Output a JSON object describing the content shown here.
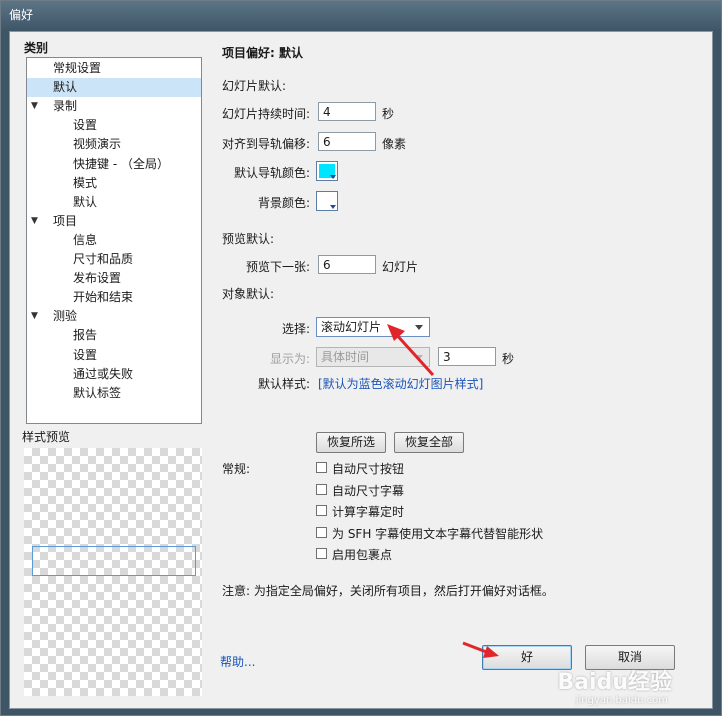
{
  "window": {
    "title": "偏好"
  },
  "sidebar": {
    "heading": "类别",
    "items": [
      {
        "label": "常规设置",
        "level": 1,
        "toggle": ""
      },
      {
        "label": "默认",
        "level": 1,
        "toggle": "",
        "selected": true
      },
      {
        "label": "录制",
        "level": 1,
        "toggle": "▼"
      },
      {
        "label": "设置",
        "level": 2,
        "toggle": ""
      },
      {
        "label": "视频演示",
        "level": 2,
        "toggle": ""
      },
      {
        "label": "快捷键 - （全局）",
        "level": 2,
        "toggle": ""
      },
      {
        "label": "模式",
        "level": 2,
        "toggle": ""
      },
      {
        "label": "默认",
        "level": 2,
        "toggle": ""
      },
      {
        "label": "项目",
        "level": 1,
        "toggle": "▼"
      },
      {
        "label": "信息",
        "level": 2,
        "toggle": ""
      },
      {
        "label": "尺寸和品质",
        "level": 2,
        "toggle": ""
      },
      {
        "label": "发布设置",
        "level": 2,
        "toggle": ""
      },
      {
        "label": "开始和结束",
        "level": 2,
        "toggle": ""
      },
      {
        "label": "测验",
        "level": 1,
        "toggle": "▼"
      },
      {
        "label": "报告",
        "level": 2,
        "toggle": ""
      },
      {
        "label": "设置",
        "level": 2,
        "toggle": ""
      },
      {
        "label": "通过或失败",
        "level": 2,
        "toggle": ""
      },
      {
        "label": "默认标签",
        "level": 2,
        "toggle": ""
      }
    ],
    "style_preview_label": "样式预览"
  },
  "main": {
    "page_title": "项目偏好: 默认",
    "slide_defaults": {
      "section": "幻灯片默认:",
      "duration_label": "幻灯片持续时间:",
      "duration_value": "4",
      "duration_unit": "秒",
      "snap_label": "对齐到导轨偏移:",
      "snap_value": "6",
      "snap_unit": "像素",
      "guide_color_label": "默认导轨颜色:",
      "guide_color": "#00e5ff",
      "bg_color_label": "背景颜色:",
      "bg_color": "#ffffff"
    },
    "preview_defaults": {
      "section": "预览默认:",
      "next_label": "预览下一张:",
      "next_value": "6",
      "next_unit": "幻灯片"
    },
    "object_defaults": {
      "section": "对象默认:",
      "select_label": "选择:",
      "select_value": "滚动幻灯片",
      "display_label": "显示为:",
      "display_value": "具体时间",
      "display_seconds": "3",
      "display_unit": "秒",
      "style_label": "默认样式:",
      "style_link": "[默认为蓝色滚动幻灯图片样式]"
    },
    "restore_selected_button": "恢复所选",
    "restore_all_button": "恢复全部",
    "general": {
      "label": "常规:",
      "options": [
        {
          "label": "自动尺寸按钮",
          "checked": false
        },
        {
          "label": "自动尺寸字幕",
          "checked": false
        },
        {
          "label": "计算字幕定时",
          "checked": false
        },
        {
          "label": "为 SFH 字幕使用文本字幕代替智能形状",
          "checked": false
        },
        {
          "label": "启用包裹点",
          "checked": false
        }
      ]
    },
    "note": "注意: 为指定全局偏好，关闭所有项目，然后打开偏好对话框。"
  },
  "footer": {
    "help_link": "帮助...",
    "ok_button": "好",
    "cancel_button": "取消"
  },
  "watermark": {
    "logo": "Baidu经验",
    "url": "jingyan.baidu.com"
  },
  "colors": {
    "annotation_arrow": "#e0262a",
    "link": "#1a54b8",
    "selection": "#cce4f7"
  }
}
